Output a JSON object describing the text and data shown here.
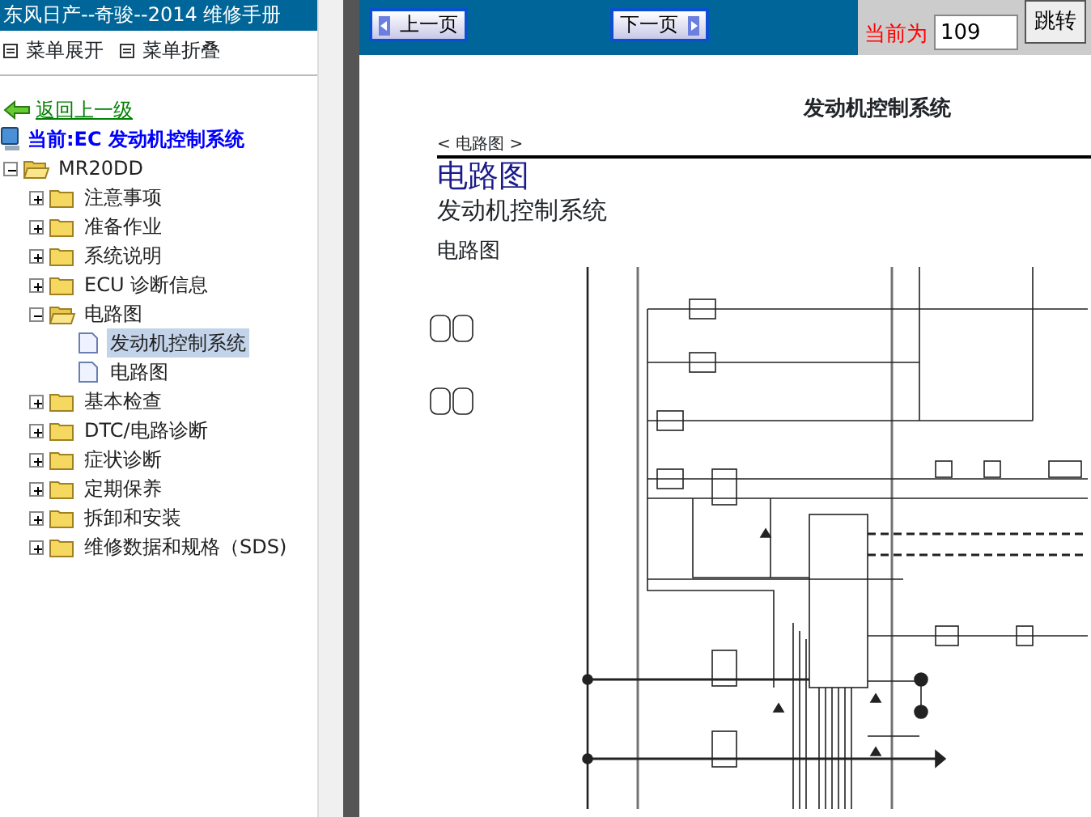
{
  "sidebar": {
    "title": "东风日产--奇骏--2014 维修手册",
    "menu": [
      {
        "label": "菜单展开"
      },
      {
        "label": "菜单折叠"
      }
    ],
    "back_link": "返回上一级",
    "current": "当前:EC 发动机控制系统",
    "tree": [
      {
        "label": "MR20DD",
        "kind": "folder",
        "expanded": true,
        "selected": false,
        "children": [
          {
            "label": "注意事项",
            "kind": "folder",
            "expanded": false,
            "selected": false
          },
          {
            "label": "准备作业",
            "kind": "folder",
            "expanded": false,
            "selected": false
          },
          {
            "label": "系统说明",
            "kind": "folder",
            "expanded": false,
            "selected": false
          },
          {
            "label": "ECU 诊断信息",
            "kind": "folder",
            "expanded": false,
            "selected": false
          },
          {
            "label": "电路图",
            "kind": "folder",
            "expanded": true,
            "selected": false,
            "children": [
              {
                "label": "发动机控制系统",
                "kind": "page",
                "selected": true
              },
              {
                "label": "电路图",
                "kind": "page",
                "selected": false
              }
            ]
          },
          {
            "label": "基本检查",
            "kind": "folder",
            "expanded": false,
            "selected": false
          },
          {
            "label": "DTC/电路诊断",
            "kind": "folder",
            "expanded": false,
            "selected": false
          },
          {
            "label": "症状诊断",
            "kind": "folder",
            "expanded": false,
            "selected": false
          },
          {
            "label": "定期保养",
            "kind": "folder",
            "expanded": false,
            "selected": false
          },
          {
            "label": "拆卸和安装",
            "kind": "folder",
            "expanded": false,
            "selected": false
          },
          {
            "label": "维修数据和规格（SDS)",
            "kind": "folder",
            "expanded": false,
            "selected": false
          }
        ]
      }
    ]
  },
  "toolbar": {
    "prev": "上一页",
    "next": "下一页",
    "current_label": "当前为",
    "page_value": "109",
    "jump": "跳转"
  },
  "document": {
    "running_head": "发动机控制系统",
    "section_tag": "< 电路图 >",
    "heading": "电路图",
    "subheading": "发动机控制系统",
    "caption": "电路图"
  }
}
